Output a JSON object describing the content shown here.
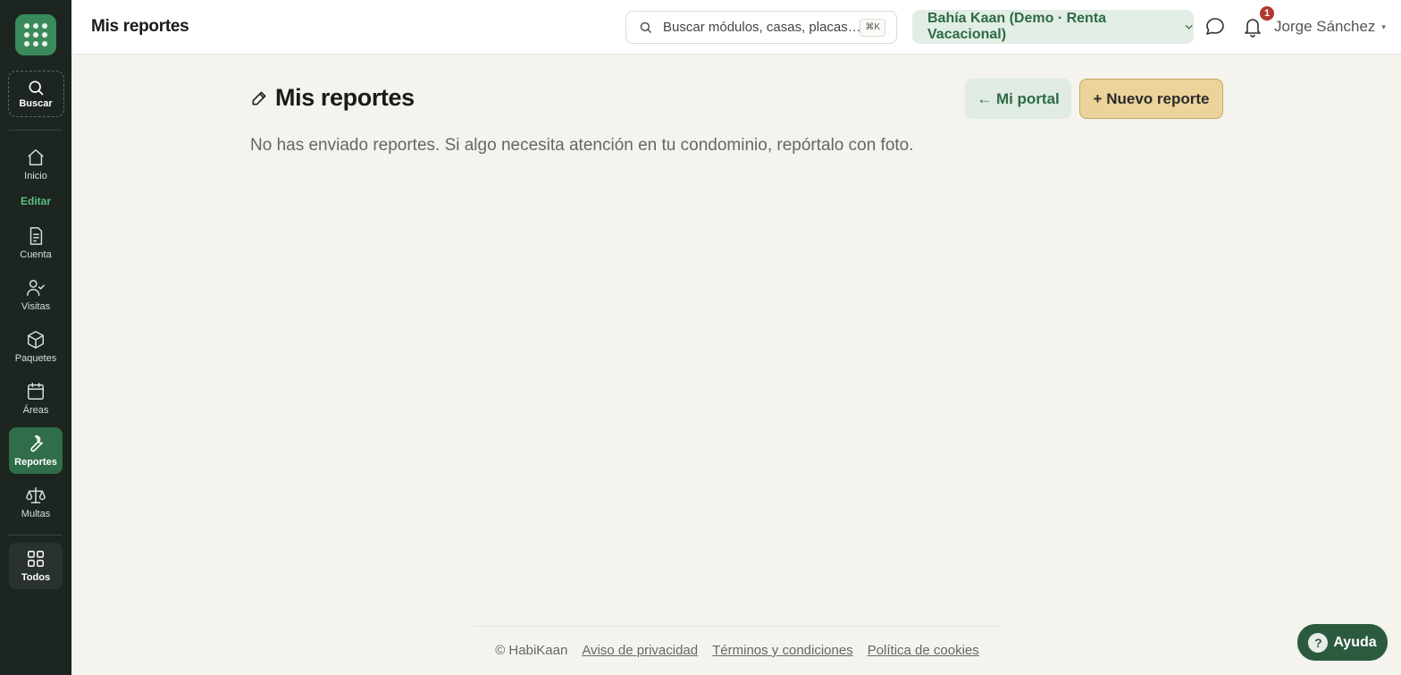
{
  "header": {
    "title": "Mis reportes",
    "search_placeholder": "Buscar módulos, casas, placas…",
    "shortcut": "⌘K",
    "site": "Bahía Kaan (Demo · Renta Vacacional)",
    "notifications": "1",
    "user": "Jorge Sánchez",
    "user_caret": "▾"
  },
  "sidebar": {
    "search": "Buscar",
    "edit": "Editar",
    "items": [
      {
        "label": "Inicio",
        "icon": "home-icon"
      },
      {
        "label": "Cuenta",
        "icon": "receipt-icon"
      },
      {
        "label": "Visitas",
        "icon": "user-check-icon"
      },
      {
        "label": "Paquetes",
        "icon": "package-icon"
      },
      {
        "label": "Áreas",
        "icon": "calendar-icon"
      },
      {
        "label": "Reportes",
        "icon": "wrench-icon"
      },
      {
        "label": "Multas",
        "icon": "scale-icon"
      }
    ],
    "all": "Todos"
  },
  "main": {
    "title": "Mis reportes",
    "portal_button": "← Mi portal",
    "new_button": "+ Nuevo reporte",
    "empty_message": "No has enviado reportes. Si algo necesita atención en tu condominio, repórtalo con foto."
  },
  "footer": {
    "copyright": "© HabiKaan",
    "privacy": "Aviso de privacidad",
    "terms": "Términos y condiciones",
    "cookies": "Política de cookies"
  },
  "help": {
    "icon": "?",
    "label": "Ayuda"
  },
  "colors": {
    "sidebar": "#1c2520",
    "accent": "#2f6e48",
    "primary_button": "#ebd39a"
  }
}
